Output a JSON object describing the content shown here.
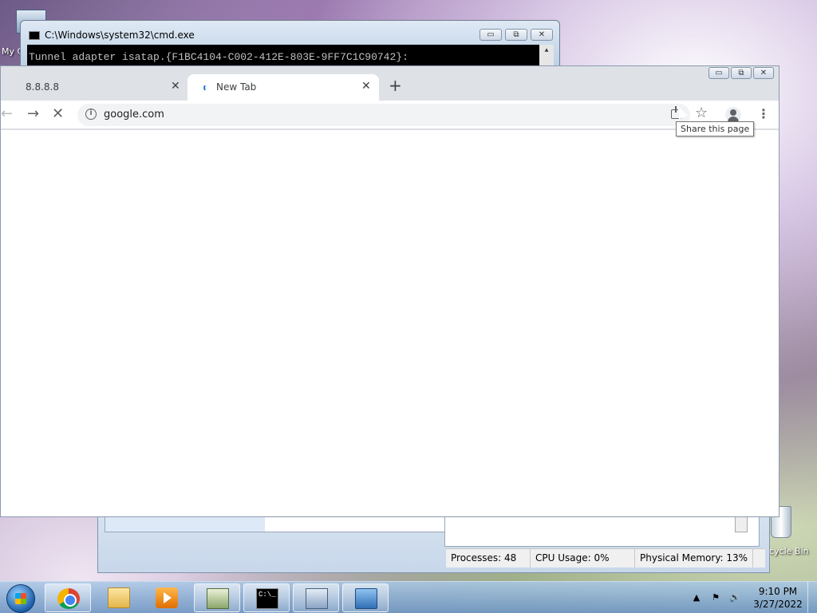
{
  "desktop": {
    "my_computer_label": "My C",
    "recycle_bin_label": "cycle Bin"
  },
  "cmd_window": {
    "title": "C:\\Windows\\system32\\cmd.exe",
    "console_line": "Tunnel adapter isatap.{F1BC4104-C002-412E-803E-9FF7C1C90742}:",
    "scroll_up": "▲",
    "minimize": "▭",
    "maximize": "⧉",
    "close": "✕"
  },
  "task_manager": {
    "processes": "Processes: 48",
    "cpu_usage": "CPU Usage: 0%",
    "physical_memory": "Physical Memory: 13%"
  },
  "chrome": {
    "window_minimize": "▭",
    "window_maximize": "⧉",
    "window_close": "✕",
    "tabs": [
      {
        "title": "8.8.8.8",
        "close": "✕"
      },
      {
        "title": "New Tab",
        "close": "✕"
      }
    ],
    "new_tab": "+",
    "nav_back": "←",
    "nav_forward": "→",
    "nav_stop": "✕",
    "url": "google.com",
    "info_icon_glyph": "i",
    "star_glyph": "☆",
    "menu_glyph": "⋮",
    "tooltip": "Share this page"
  },
  "taskbar": {
    "apps": [
      "chrome-icon",
      "folder-icon",
      "media-player-icon",
      "task-manager-icon",
      "cmd-icon",
      "network-icon",
      "control-panel-icon"
    ],
    "cmd_glyph": "C:\\_",
    "tray_up": "▲",
    "tray_volume": "🔊",
    "tray_flag": "⚑",
    "time": "9:10 PM",
    "date": "3/27/2022"
  }
}
